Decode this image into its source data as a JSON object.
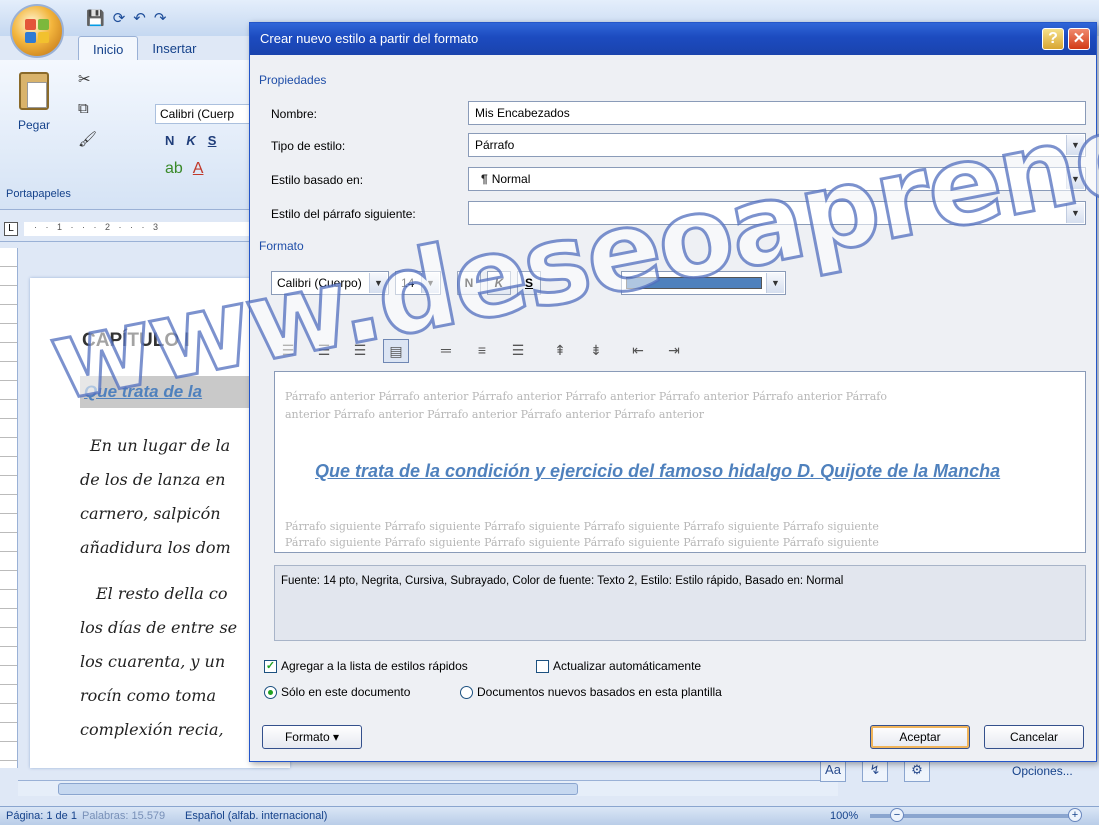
{
  "word": {
    "tabs": [
      {
        "label": "Inicio"
      },
      {
        "label": "Insertar"
      }
    ],
    "clipboard": {
      "paste_label": "Pegar",
      "group_label": "Portapapeles"
    },
    "font_box": "Calibri (Cuerp",
    "font_buttons": [
      "N",
      "K",
      "S"
    ],
    "document": {
      "chapter": "CAPÍTULO I",
      "heading": "Que trata de la",
      "lines": [
        "En un lugar de la",
        "de los de lanza en",
        "carnero, salpicón",
        "añadidura los dom",
        "El resto della co",
        "los días de entre se",
        "los cuarenta, y un",
        "rocín como toma",
        "complexión recia,"
      ]
    },
    "options_link": "Opciones...",
    "status": {
      "page": "Página: 1 de 1",
      "words": "Palabras: 15.579",
      "language": "Español (alfab. internacional)",
      "zoom": "100%",
      "zoom_minus": "−",
      "zoom_plus": "+"
    }
  },
  "dialog": {
    "title": "Crear nuevo estilo a partir del formato",
    "help": "?",
    "close": "✕",
    "properties_section": "Propiedades",
    "fields": {
      "name_label": "Nombre:",
      "name_value": "Mis Encabezados",
      "style_type_label": "Tipo de estilo:",
      "style_type_value": "Párrafo",
      "based_on_label": "Estilo basado en:",
      "based_on_value": "Normal",
      "next_para_label": "Estilo del párrafo siguiente:",
      "next_para_value": ""
    },
    "format_section": "Formato",
    "format_toolbar": {
      "font": "Calibri (Cuerpo)",
      "size": "14",
      "bold": "N",
      "italic": "K",
      "underline": "S",
      "color": "#4f81bd"
    },
    "preview": {
      "prev_ghost_1": "Párrafo anterior Párrafo anterior Párrafo anterior Párrafo anterior Párrafo anterior Párrafo anterior Párrafo",
      "prev_ghost_2": "anterior Párrafo anterior Párrafo anterior Párrafo anterior Párrafo anterior",
      "sample": "Que trata de la condición y ejercicio del famoso hidalgo D. Quijote de la Mancha",
      "next_ghost_1": "Párrafo siguiente Párrafo siguiente Párrafo siguiente Párrafo siguiente Párrafo siguiente Párrafo siguiente",
      "next_ghost_2": "Párrafo siguiente Párrafo siguiente Párrafo siguiente Párrafo siguiente Párrafo siguiente Párrafo siguiente"
    },
    "description": "Fuente: 14 pto, Negrita, Cursiva, Subrayado, Color de fuente: Texto 2, Estilo: Estilo rápido, Basado en: Normal",
    "options": {
      "add_quick_styles": "Agregar a la lista de estilos rápidos",
      "auto_update": "Actualizar automáticamente",
      "only_this_doc": "Sólo en este documento",
      "new_docs": "Documentos nuevos basados en esta plantilla"
    },
    "buttons": {
      "format": "Formato ▾",
      "accept": "Aceptar",
      "cancel": "Cancelar"
    }
  },
  "watermark": "www.deseoaprender.com"
}
